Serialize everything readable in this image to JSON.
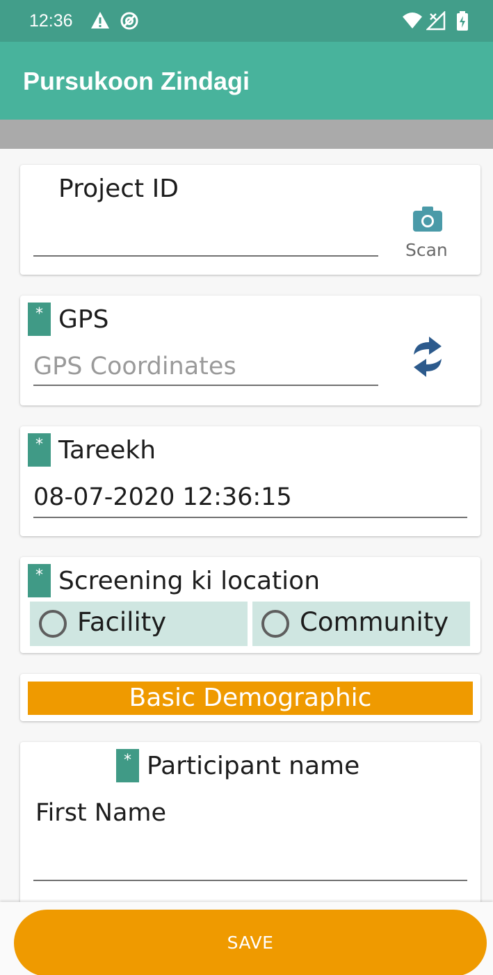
{
  "status_bar": {
    "time": "12:36",
    "icons": [
      "warning-icon",
      "at-sync-icon",
      "wifi-icon",
      "no-signal-icon",
      "battery-charging-icon"
    ]
  },
  "app_bar": {
    "title": "Pursukoon Zindagi"
  },
  "project_id": {
    "label": "Project ID",
    "value": "",
    "scan_label": "Scan",
    "scan_icon": "camera-icon"
  },
  "gps": {
    "required_mark": "*",
    "label": "GPS",
    "placeholder": "GPS Coordinates",
    "refresh_icon": "refresh-icon"
  },
  "tareekh": {
    "required_mark": "*",
    "label": "Tareekh",
    "value": "08-07-2020 12:36:15"
  },
  "screening_location": {
    "required_mark": "*",
    "label": "Screening ki location",
    "options": [
      "Facility",
      "Community"
    ]
  },
  "section": {
    "title": "Basic Demographic"
  },
  "participant": {
    "required_mark": "*",
    "label": "Participant name",
    "first_name_label": "First Name",
    "first_name_value": ""
  },
  "footer": {
    "save_label": "SAVE"
  },
  "colors": {
    "status_bar": "#429e8a",
    "app_bar": "#48b39c",
    "required_badge": "#409a86",
    "accent_orange": "#ef9a00",
    "radio_bg": "#cfe6e1",
    "refresh_icon": "#2c5a8c"
  }
}
